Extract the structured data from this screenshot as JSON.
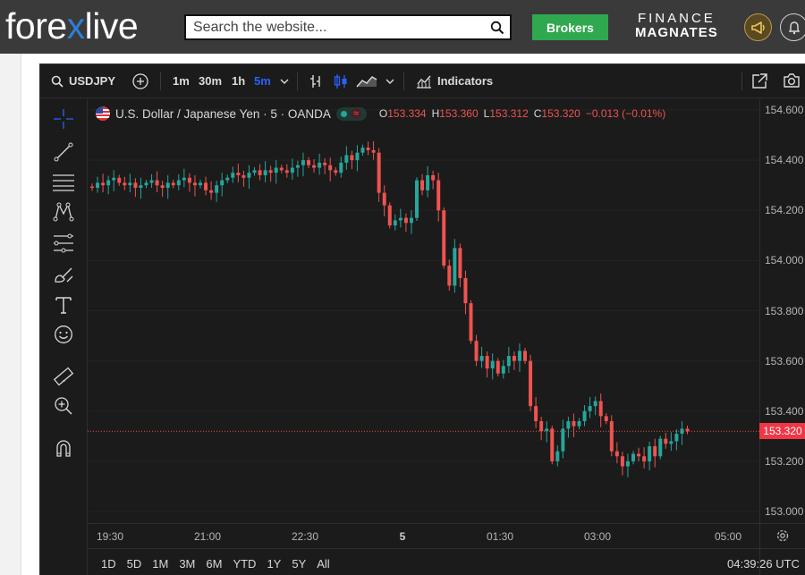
{
  "site": {
    "logo_part1": "fore",
    "logo_x": "x",
    "logo_part2": "live",
    "search_placeholder": "Search the website...",
    "brokers_label": "Brokers",
    "partner_line1": "FINANCE",
    "partner_line2": "MAGNATES",
    "icons": [
      "search-icon",
      "megaphone-icon",
      "bell-icon"
    ]
  },
  "toolbar": {
    "symbol": "USDJPY",
    "timeframes": [
      "1m",
      "30m",
      "1h",
      "5m"
    ],
    "active_timeframe": "5m",
    "indicators_label": "Indicators"
  },
  "legend": {
    "title": "U.S. Dollar / Japanese Yen · 5 · OANDA",
    "o_label": "O",
    "o_value": "153.334",
    "h_label": "H",
    "h_value": "153.360",
    "l_label": "L",
    "l_value": "153.312",
    "c_label": "C",
    "c_value": "153.320",
    "change": "−0.013 (−0.01%)"
  },
  "price_axis": [
    "154.600",
    "154.400",
    "154.200",
    "154.000",
    "153.800",
    "153.600",
    "153.400",
    "153.200",
    "153.000"
  ],
  "current_price": "153.320",
  "time_axis": [
    "19:30",
    "21:00",
    "22:30",
    "5",
    "01:30",
    "03:00",
    "05:00"
  ],
  "range_buttons": [
    "1D",
    "5D",
    "1M",
    "3M",
    "6M",
    "YTD",
    "1Y",
    "5Y",
    "All"
  ],
  "clock": "04:39:26 UTC",
  "colors": {
    "up": "#26a69a",
    "down": "#ef5350",
    "background": "#1b1b1b",
    "active": "#2962ff"
  },
  "chart_data": {
    "type": "candlestick",
    "symbol": "USDJPY",
    "interval": "5",
    "ylim": [
      153.0,
      154.6
    ],
    "x_ticks": [
      "19:30",
      "21:00",
      "22:30",
      "5",
      "01:30",
      "03:00",
      "05:00"
    ],
    "close_approx": [
      154.29,
      154.31,
      154.3,
      154.32,
      154.33,
      154.31,
      154.3,
      154.31,
      154.29,
      154.3,
      154.31,
      154.32,
      154.3,
      154.29,
      154.31,
      154.3,
      154.32,
      154.33,
      154.31,
      154.3,
      154.31,
      154.28,
      154.27,
      154.3,
      154.32,
      154.33,
      154.35,
      154.34,
      154.33,
      154.35,
      154.36,
      154.34,
      154.36,
      154.35,
      154.37,
      154.36,
      154.35,
      154.37,
      154.38,
      154.4,
      154.38,
      154.37,
      154.39,
      154.38,
      154.36,
      154.35,
      154.39,
      154.42,
      154.4,
      154.43,
      154.45,
      154.44,
      154.43,
      154.27,
      154.22,
      154.14,
      154.16,
      154.17,
      154.15,
      154.17,
      154.32,
      154.28,
      154.34,
      154.32,
      154.2,
      153.98,
      153.9,
      154.05,
      153.93,
      153.83,
      153.68,
      153.6,
      153.62,
      153.57,
      153.6,
      153.55,
      153.58,
      153.62,
      153.6,
      153.64,
      153.6,
      153.42,
      153.36,
      153.32,
      153.33,
      153.2,
      153.24,
      153.33,
      153.36,
      153.34,
      153.36,
      153.4,
      153.42,
      153.44,
      153.38,
      153.36,
      153.24,
      153.22,
      153.18,
      153.2,
      153.23,
      153.22,
      153.2,
      153.26,
      153.22,
      153.29,
      153.27,
      153.28,
      153.31,
      153.33,
      153.32
    ]
  }
}
